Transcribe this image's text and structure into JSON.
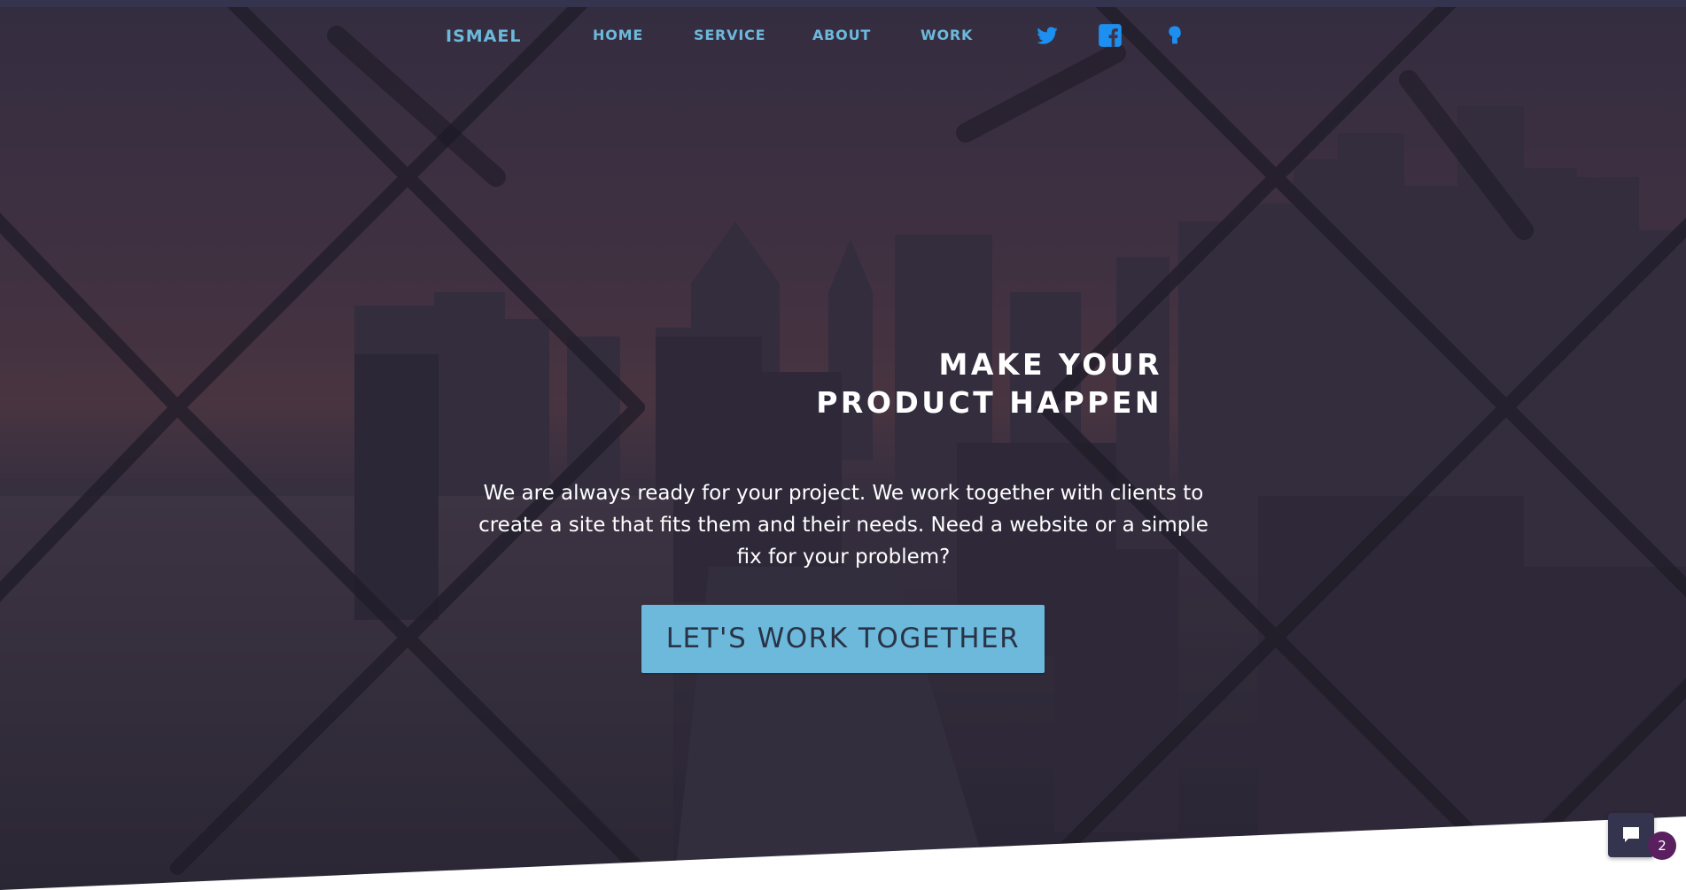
{
  "nav": {
    "brand": "ISMAEL",
    "links": [
      {
        "label": "HOME"
      },
      {
        "label": "SERVICE"
      },
      {
        "label": "ABOUT"
      },
      {
        "label": "WORK"
      }
    ],
    "social": [
      {
        "icon": "twitter-icon"
      },
      {
        "icon": "facebook-icon"
      },
      {
        "icon": "github-icon"
      }
    ]
  },
  "hero": {
    "headline_line1": "MAKE YOUR",
    "headline_line2": "PRODUCT HAPPEN",
    "lead": "We are always ready for your project. We work together with clients to create a site that fits them and their needs. Need a website or a simple fix for your problem?",
    "cta_label": "LET'S WORK TOGETHER"
  },
  "chat": {
    "icon": "chat-bubble-icon",
    "badge_count": "2"
  },
  "colors": {
    "accent": "#6cb9dc",
    "topbar": "#34344e",
    "cta_text": "#2a3345",
    "badge": "#5a1f5e",
    "white": "#ffffff"
  }
}
